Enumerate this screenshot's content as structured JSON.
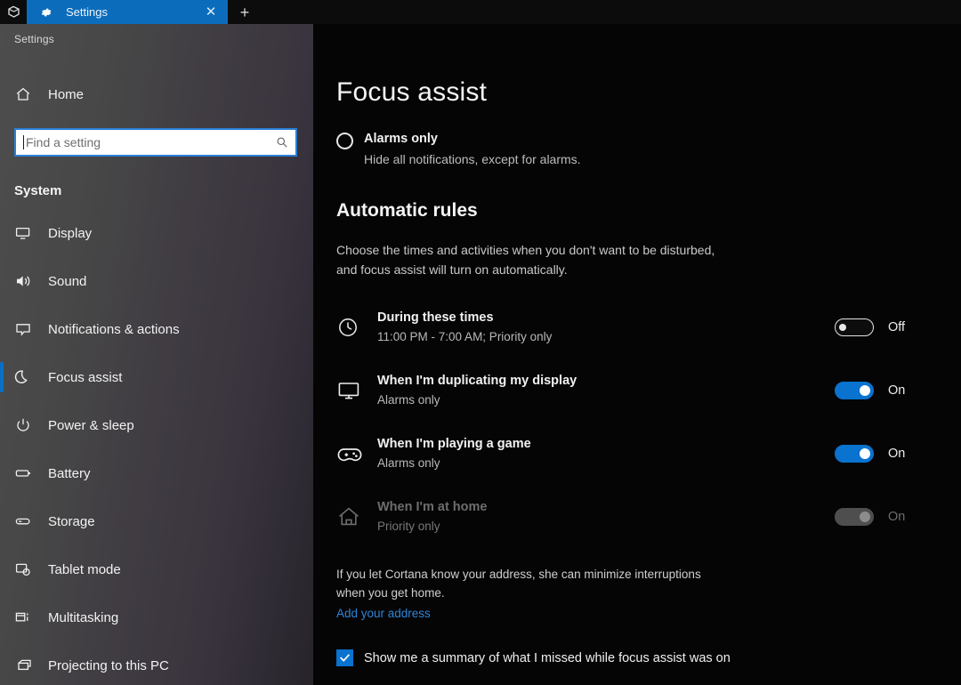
{
  "window": {
    "app_icon": "sets-app-icon",
    "tab": {
      "icon": "gear-icon",
      "title": "Settings",
      "close_label": "✕"
    },
    "new_tab_label": "+"
  },
  "sidebar": {
    "app_title": "Settings",
    "home": {
      "icon": "home-icon",
      "label": "Home"
    },
    "search": {
      "placeholder": "Find a setting",
      "value": "",
      "icon": "search-icon"
    },
    "group_header": "System",
    "items": [
      {
        "icon": "display-icon",
        "label": "Display",
        "selected": false
      },
      {
        "icon": "sound-icon",
        "label": "Sound",
        "selected": false
      },
      {
        "icon": "notifications-icon",
        "label": "Notifications & actions",
        "selected": false
      },
      {
        "icon": "moon-icon",
        "label": "Focus assist",
        "selected": true
      },
      {
        "icon": "power-icon",
        "label": "Power & sleep",
        "selected": false
      },
      {
        "icon": "battery-icon",
        "label": "Battery",
        "selected": false
      },
      {
        "icon": "storage-icon",
        "label": "Storage",
        "selected": false
      },
      {
        "icon": "tablet-icon",
        "label": "Tablet mode",
        "selected": false
      },
      {
        "icon": "multitasking-icon",
        "label": "Multitasking",
        "selected": false
      },
      {
        "icon": "projecting-icon",
        "label": "Projecting to this PC",
        "selected": false
      }
    ]
  },
  "main": {
    "page_title": "Focus assist",
    "mode": {
      "selected": false,
      "title": "Alarms only",
      "description": "Hide all notifications, except for alarms."
    },
    "rules_heading": "Automatic rules",
    "rules_description": "Choose the times and activities when you don't want to be disturbed, and focus assist will turn on automatically.",
    "rules": [
      {
        "icon": "clock-icon",
        "title": "During these times",
        "subtitle": "11:00 PM - 7:00 AM; Priority only",
        "state": "off",
        "state_label": "Off",
        "disabled": false
      },
      {
        "icon": "monitor-icon",
        "title": "When I'm duplicating my display",
        "subtitle": "Alarms only",
        "state": "on",
        "state_label": "On",
        "disabled": false
      },
      {
        "icon": "gamepad-icon",
        "title": "When I'm playing a game",
        "subtitle": "Alarms only",
        "state": "on",
        "state_label": "On",
        "disabled": false
      },
      {
        "icon": "house-icon",
        "title": "When I'm at home",
        "subtitle": "Priority only",
        "state": "on",
        "state_label": "On",
        "disabled": true
      }
    ],
    "cortana_note": "If you let Cortana know your address, she can minimize interruptions when you get home.",
    "address_link": "Add your address",
    "summary_checkbox": {
      "checked": true,
      "label": "Show me a summary of what I missed while focus assist was on"
    }
  },
  "colors": {
    "accent": "#0a72cf",
    "tab_active": "#0b6cbb",
    "link": "#2f84d8",
    "content_bg": "#050505"
  }
}
